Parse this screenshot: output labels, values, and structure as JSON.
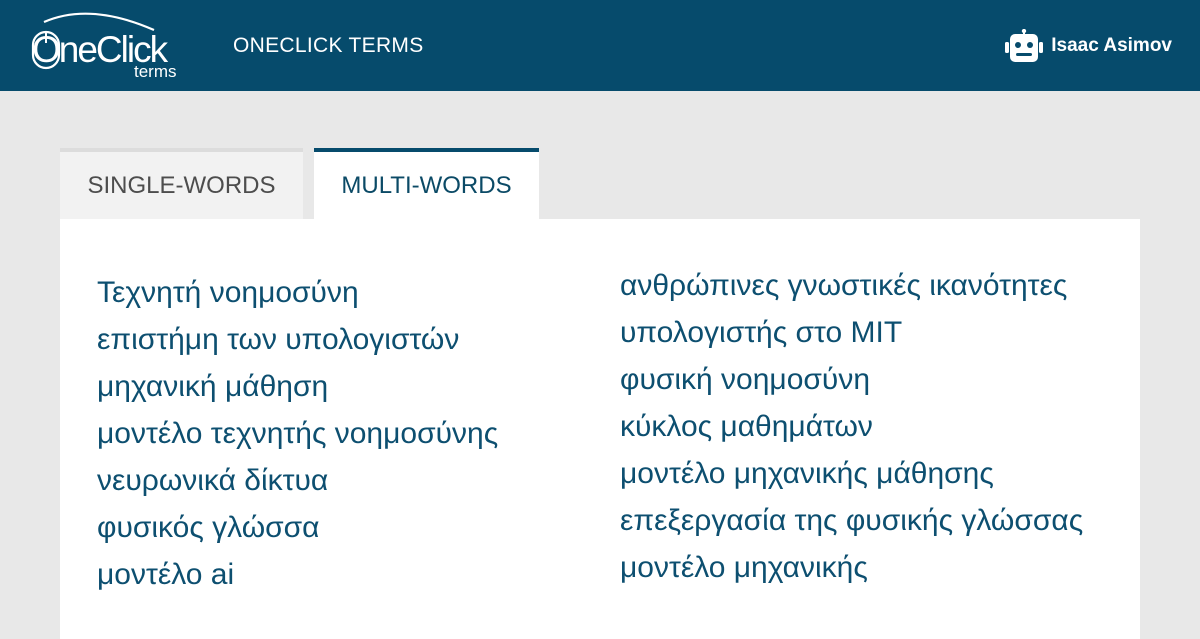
{
  "header": {
    "logo": {
      "main": "OneClick",
      "sub": "terms"
    },
    "app_title": "ONECLICK TERMS",
    "user": {
      "name": "Isaac Asimov",
      "icon": "robot-icon"
    },
    "colors": {
      "bar": "#064b6c",
      "text": "#ffffff"
    }
  },
  "tabs": [
    {
      "label": "SINGLE-WORDS",
      "active": false
    },
    {
      "label": "MULTI-WORDS",
      "active": true
    }
  ],
  "terms": {
    "left": [
      "Τεχνητή νοημοσύνη",
      "επιστήμη των υπολογιστών",
      "μηχανική μάθηση",
      "μοντέλο τεχνητής νοημοσύνης",
      "νευρωνικά δίκτυα",
      "φυσικός γλώσσα",
      "μοντέλο ai"
    ],
    "right": [
      "ανθρώπινες γνωστικές ικανότητες",
      "υπολογιστής στο MIT",
      "φυσική νοημοσύνη",
      "κύκλος μαθημάτων",
      "μοντέλο μηχανικής μάθησης",
      "επεξεργασία της φυσικής γλώσσας",
      "μοντέλο μηχανικής"
    ],
    "link_color": "#0d4f70"
  }
}
